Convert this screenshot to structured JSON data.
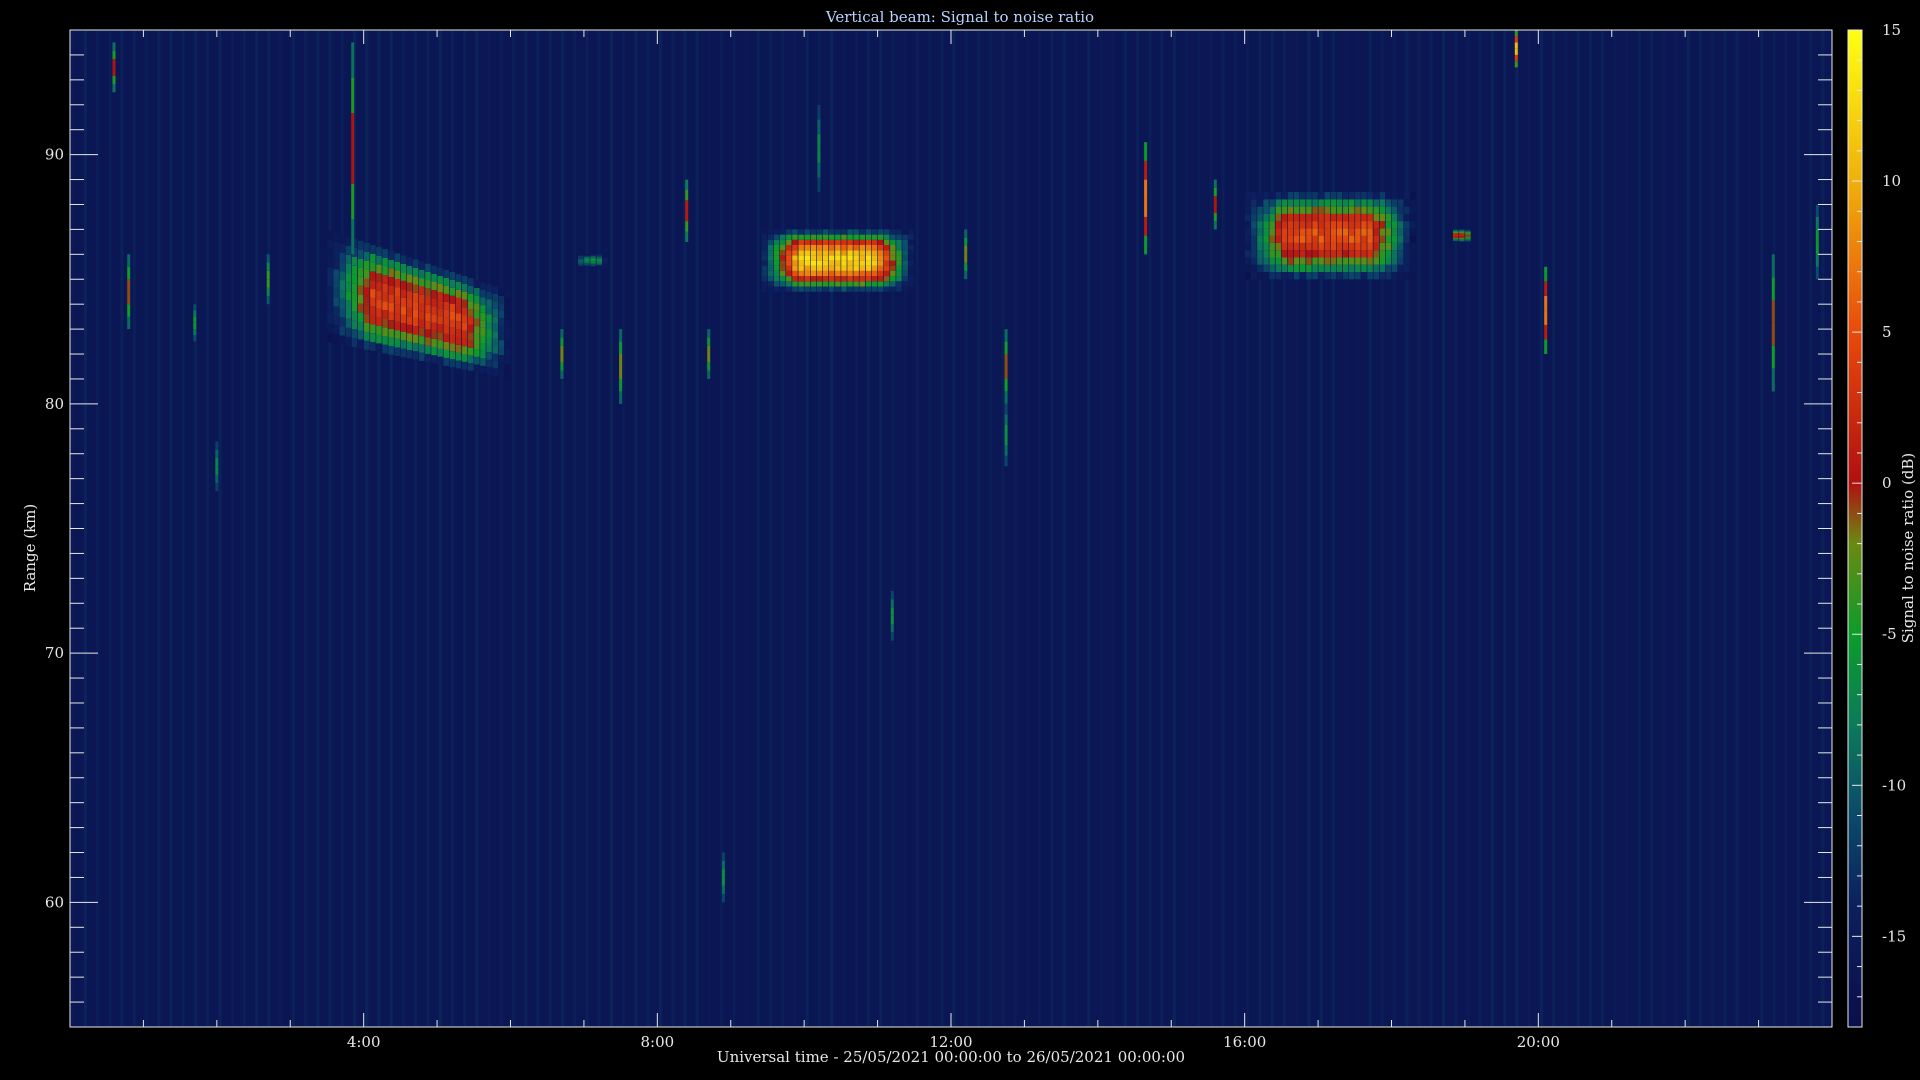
{
  "chart_data": {
    "type": "heatmap",
    "title": "Vertical beam: Signal to noise ratio",
    "xlabel": "Universal time - 25/05/2021 00:00:00 to 26/05/2021 00:00:00",
    "ylabel": "Range (km)",
    "colorbar_label": "Signal to noise ratio (dB)",
    "x_range_hours": [
      0,
      24
    ],
    "y_range_km": [
      55,
      95
    ],
    "color_range_db": [
      -18,
      15
    ],
    "x_ticks": [
      {
        "value": 4,
        "label": "4:00"
      },
      {
        "value": 8,
        "label": "8:00"
      },
      {
        "value": 12,
        "label": "12:00"
      },
      {
        "value": 16,
        "label": "16:00"
      },
      {
        "value": 20,
        "label": "20:00"
      }
    ],
    "y_ticks": [
      {
        "value": 60,
        "label": "60"
      },
      {
        "value": 70,
        "label": "70"
      },
      {
        "value": 80,
        "label": "80"
      },
      {
        "value": 90,
        "label": "90"
      }
    ],
    "colorbar_ticks": [
      {
        "value": 15,
        "label": "15"
      },
      {
        "value": 10,
        "label": "10"
      },
      {
        "value": 5,
        "label": "5"
      },
      {
        "value": 0,
        "label": "0"
      },
      {
        "value": -5,
        "label": "-5"
      },
      {
        "value": -10,
        "label": "-10"
      },
      {
        "value": -15,
        "label": "-15"
      }
    ],
    "colormap": [
      {
        "db": -18,
        "color": "#0a0f4a"
      },
      {
        "db": -14,
        "color": "#0c1f5e"
      },
      {
        "db": -11,
        "color": "#0b4a6a"
      },
      {
        "db": -8,
        "color": "#0c7a5a"
      },
      {
        "db": -5,
        "color": "#0c9c2a"
      },
      {
        "db": -2,
        "color": "#6a8a12"
      },
      {
        "db": 0,
        "color": "#b01010"
      },
      {
        "db": 5,
        "color": "#e84a0c"
      },
      {
        "db": 10,
        "color": "#f0b00c"
      },
      {
        "db": 15,
        "color": "#ffff10"
      }
    ],
    "background_db": -16,
    "echo_regions": [
      {
        "t_start": 3.5,
        "t_end": 6.0,
        "range_low_km": 81,
        "range_high_km": 87,
        "peak_db": 4
      },
      {
        "t_start": 9.4,
        "t_end": 11.5,
        "range_low_km": 83,
        "range_high_km": 87,
        "peak_db": 12
      },
      {
        "t_start": 16.0,
        "t_end": 18.3,
        "range_low_km": 83.5,
        "range_high_km": 88.5,
        "peak_db": 5
      },
      {
        "t_start": 18.8,
        "t_end": 19.1,
        "range_low_km": 85,
        "range_high_km": 87,
        "peak_db": 2
      },
      {
        "t_start": 6.9,
        "t_end": 7.3,
        "range_low_km": 84,
        "range_high_km": 86,
        "peak_db": -6
      }
    ],
    "vertical_streaks": [
      {
        "t": 0.6,
        "range_low_km": 92.5,
        "range_high_km": 94.5,
        "peak_db": 2
      },
      {
        "t": 0.8,
        "range_low_km": 83,
        "range_high_km": 86,
        "peak_db": 1
      },
      {
        "t": 1.7,
        "range_low_km": 82.5,
        "range_high_km": 84,
        "peak_db": -4
      },
      {
        "t": 2.7,
        "range_low_km": 84,
        "range_high_km": 86,
        "peak_db": -2
      },
      {
        "t": 3.85,
        "range_low_km": 86,
        "range_high_km": 94.5,
        "peak_db": 2
      },
      {
        "t": 6.7,
        "range_low_km": 81,
        "range_high_km": 83,
        "peak_db": 0
      },
      {
        "t": 7.5,
        "range_low_km": 80,
        "range_high_km": 83,
        "peak_db": 0
      },
      {
        "t": 8.4,
        "range_low_km": 86.5,
        "range_high_km": 89,
        "peak_db": 3
      },
      {
        "t": 8.7,
        "range_low_km": 81,
        "range_high_km": 83,
        "peak_db": 0
      },
      {
        "t": 12.2,
        "range_low_km": 85,
        "range_high_km": 87,
        "peak_db": 0
      },
      {
        "t": 12.75,
        "range_low_km": 80,
        "range_high_km": 83,
        "peak_db": 1
      },
      {
        "t": 12.75,
        "range_low_km": 77.5,
        "range_high_km": 80,
        "peak_db": -5
      },
      {
        "t": 14.65,
        "range_low_km": 86,
        "range_high_km": 90.5,
        "peak_db": 10
      },
      {
        "t": 15.6,
        "range_low_km": 87,
        "range_high_km": 89,
        "peak_db": 2
      },
      {
        "t": 19.7,
        "range_low_km": 93.5,
        "range_high_km": 95,
        "peak_db": 14
      },
      {
        "t": 20.1,
        "range_low_km": 82,
        "range_high_km": 85.5,
        "peak_db": 10
      },
      {
        "t": 23.2,
        "range_low_km": 80.5,
        "range_high_km": 86,
        "peak_db": 1
      },
      {
        "t": 23.8,
        "range_low_km": 85,
        "range_high_km": 88,
        "peak_db": -4
      },
      {
        "t": 11.2,
        "range_low_km": 70.5,
        "range_high_km": 72.5,
        "peak_db": -5
      },
      {
        "t": 8.9,
        "range_low_km": 60,
        "range_high_km": 62,
        "peak_db": -5
      },
      {
        "t": 10.2,
        "range_low_km": 88.5,
        "range_high_km": 92,
        "peak_db": -6
      },
      {
        "t": 2.0,
        "range_low_km": 76.5,
        "range_high_km": 78.5,
        "peak_db": -6
      }
    ]
  }
}
